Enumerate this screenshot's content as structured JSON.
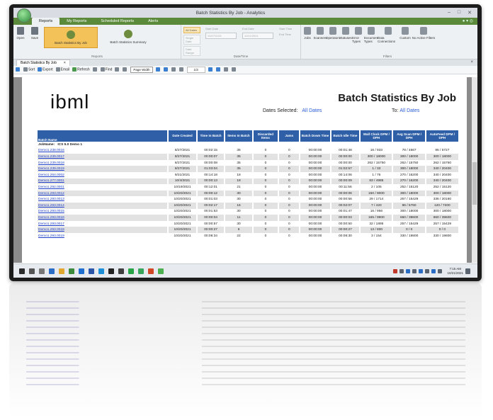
{
  "window": {
    "title": "Batch Statistics By Job - Analytics",
    "controls": [
      "–",
      "□",
      "✕"
    ]
  },
  "tabs": [
    "Reports",
    "My Reports",
    "Scheduled Reports",
    "Alerts"
  ],
  "ribbon": {
    "open": "Open",
    "save": "Save",
    "report_selected": "Batch Statistics By Job",
    "report_other": "Batch Statistics Summary",
    "group_reports": "Reports",
    "date_options": [
      "All Dates",
      "Single Date",
      "Date Range"
    ],
    "start_date_label": "Start Date",
    "end_date_label": "End Date",
    "start_date": "10/27/2021",
    "end_date": "11/01/2021",
    "start_time": "Start Time",
    "end_time": "End Time",
    "group_datetime": "Date/Time",
    "filters": [
      "Jobs",
      "Scanners",
      "Operators",
      "Statuses",
      "Error Types",
      "Document Types",
      "Data Connections",
      "Custom"
    ],
    "no_filters": "No Active Filters",
    "group_filters": "Filters"
  },
  "doc_tab": "Batch Statistics By Job",
  "toolbar": {
    "sort": "Sort",
    "export": "Export",
    "email": "Email",
    "refresh": "Refresh",
    "find": "Find",
    "zoom": "Page Width",
    "page": "1/3"
  },
  "report": {
    "logo": "ibml",
    "title": "Batch Statistics By Job",
    "dates_selected_label": "Dates Selected:",
    "dates_selected_value": "All Dates",
    "to_label": "To:",
    "to_value": "All Dates",
    "columns": [
      "Batch Name",
      "Date Created",
      "Time In Batch",
      "Items In Batch",
      "Discarded Items",
      "Jams",
      "Batch Down Time",
      "Batch Idle Time",
      "Wall Clock DPM / DPH",
      "Avg Scan DPM / DPH",
      "AutoFeed DPM / DPH"
    ],
    "job_label": "JobName:",
    "job_name": "ICS 5.0 Demo 1",
    "rows": [
      [
        "Demo1.238.0016",
        "8/27/2021",
        "00:02:15",
        "35",
        "0",
        "0",
        "00:00:00",
        "00:01:48",
        "16 / 933",
        "78 / 4667",
        "95 / 5727"
      ],
      [
        "Demo1.239.0017",
        "8/27/2021",
        "00:00:07",
        "35",
        "0",
        "0",
        "00:00:00",
        "00:00:00",
        "300 / 18000",
        "300 / 18000",
        "300 / 18000"
      ],
      [
        "Demo1.239.0018",
        "8/27/2021",
        "00:00:08",
        "35",
        "0",
        "0",
        "00:00:00",
        "00:00:00",
        "262 / 15750",
        "262 / 15750",
        "262 / 15750"
      ],
      [
        "Demo1.239.0019",
        "8/27/2021",
        "01:03:04",
        "35",
        "0",
        "0",
        "00:00:00",
        "01:02:57",
        "1 / 33",
        "300 / 18000",
        "340 / 20400"
      ],
      [
        "Demo1.264.0002",
        "9/21/2021",
        "00:14:18",
        "18",
        "0",
        "0",
        "00:00:00",
        "00:14:06",
        "1 / 76",
        "270 / 16200",
        "340 / 20400"
      ],
      [
        "Demo1.277.0001",
        "10/4/2021",
        "00:00:13",
        "18",
        "0",
        "0",
        "00:00:00",
        "00:00:09",
        "83 / 4985",
        "270 / 16200",
        "340 / 20400"
      ],
      [
        "Demo1.292.0001",
        "10/19/2021",
        "00:12:01",
        "21",
        "0",
        "0",
        "00:00:00",
        "00:11:56",
        "2 / 105",
        "252 / 15120",
        "252 / 15120"
      ],
      [
        "Demo1.293.0012",
        "10/20/2021",
        "00:00:12",
        "30",
        "0",
        "0",
        "00:00:00",
        "00:00:06",
        "150 / 9000",
        "300 / 18000",
        "300 / 18000"
      ],
      [
        "Demo1.293.0013",
        "10/20/2021",
        "00:01:03",
        "30",
        "0",
        "0",
        "00:00:00",
        "00:00:56",
        "29 / 1714",
        "257 / 15429",
        "336 / 20160"
      ],
      [
        "Demo1.293.0014",
        "10/20/2021",
        "00:02:17",
        "16",
        "0",
        "0",
        "00:00:00",
        "00:02:07",
        "7 / 420",
        "96 / 5760",
        "120 / 7200"
      ],
      [
        "Demo1.293.0015",
        "10/20/2021",
        "00:01:53",
        "30",
        "0",
        "0",
        "00:00:00",
        "00:01:47",
        "16 / 956",
        "300 / 18000",
        "300 / 18000"
      ],
      [
        "Demo1.293.0016",
        "10/20/2021",
        "00:00:04",
        "11",
        "0",
        "0",
        "00:00:00",
        "00:00:03",
        "165 / 9900",
        "660 / 39600",
        "660 / 39600"
      ],
      [
        "Demo1.293.0017",
        "10/20/2021",
        "00:00:57",
        "30",
        "0",
        "0",
        "00:00:00",
        "00:00:50",
        "32 / 1895",
        "257 / 15429",
        "257 / 15429"
      ],
      [
        "Demo1.293.0018",
        "10/20/2021",
        "00:00:27",
        "6",
        "0",
        "0",
        "00:00:00",
        "00:00:27",
        "13 / 800",
        "0 / 0",
        "0 / 0"
      ],
      [
        "Demo1.293.0019",
        "10/20/2021",
        "00:08:34",
        "22",
        "0",
        "0",
        "00:00:00",
        "00:08:30",
        "3 / 154",
        "330 / 19800",
        "330 / 19800"
      ]
    ]
  },
  "taskbar": {
    "time": "7:15 AM",
    "date": "10/21/2021"
  },
  "colors": {
    "accent": "#2f5fa6",
    "tab_bar": "#5a8a3a",
    "selected_report": "#f3c35a",
    "link": "#1d3fc9"
  }
}
